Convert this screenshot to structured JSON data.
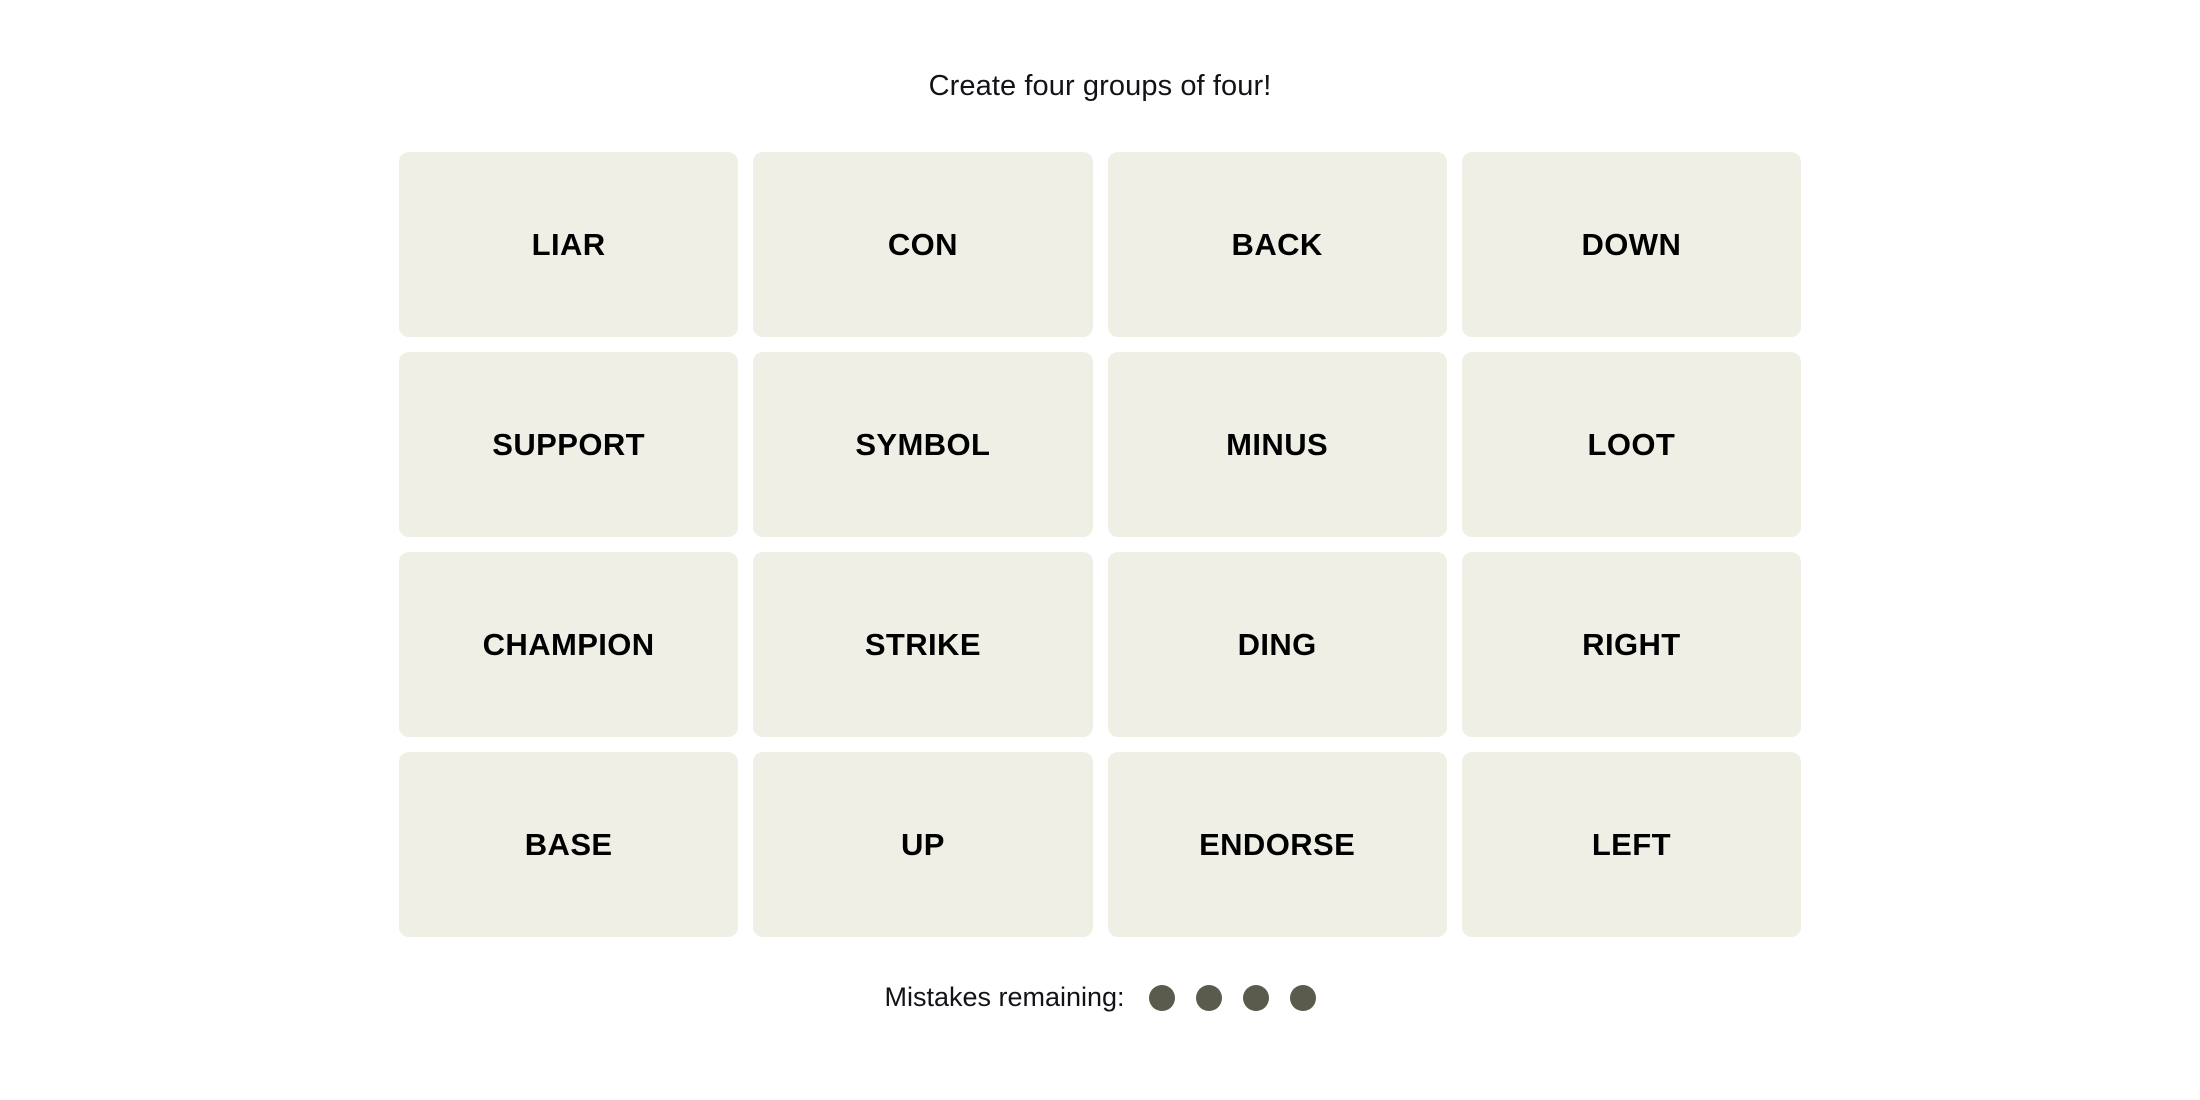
{
  "header": {
    "title": "Create four groups of four!"
  },
  "board": {
    "rows": 4,
    "columns": 4,
    "tiles": [
      {
        "label": "LIAR"
      },
      {
        "label": "CON"
      },
      {
        "label": "BACK"
      },
      {
        "label": "DOWN"
      },
      {
        "label": "SUPPORT"
      },
      {
        "label": "SYMBOL"
      },
      {
        "label": "MINUS"
      },
      {
        "label": "LOOT"
      },
      {
        "label": "CHAMPION"
      },
      {
        "label": "STRIKE"
      },
      {
        "label": "DING"
      },
      {
        "label": "RIGHT"
      },
      {
        "label": "BASE"
      },
      {
        "label": "UP"
      },
      {
        "label": "ENDORSE"
      },
      {
        "label": "LEFT"
      }
    ]
  },
  "footer": {
    "mistakes_label": "Mistakes remaining:",
    "mistakes_remaining": 4,
    "dots": [
      {
        "name": "mistake-dot-1"
      },
      {
        "name": "mistake-dot-2"
      },
      {
        "name": "mistake-dot-3"
      },
      {
        "name": "mistake-dot-4"
      }
    ]
  },
  "colors": {
    "page_background": "#ffffff",
    "tile_background": "#efefe6",
    "tile_text": "#000000",
    "title_text": "#121217",
    "dot_fill": "#5a5b4c"
  }
}
